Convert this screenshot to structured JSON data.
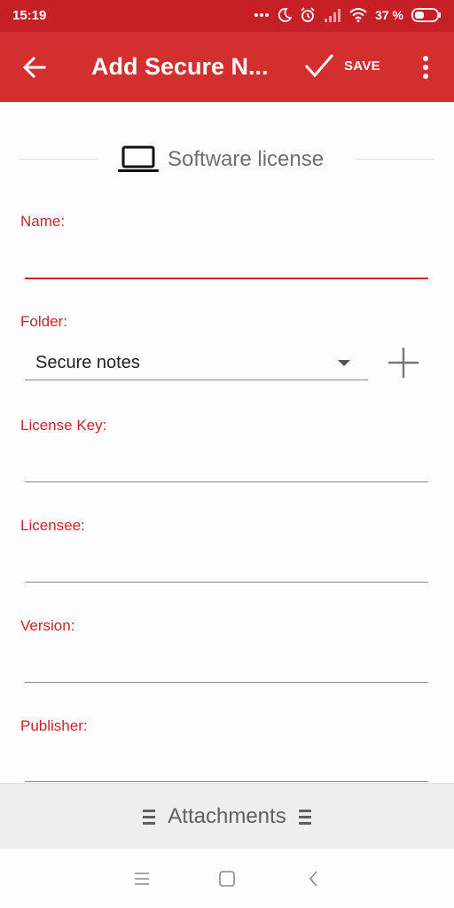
{
  "status_bar": {
    "time": "15:19",
    "battery_percent": "37 %",
    "icons": [
      "more-dots-icon",
      "moon-icon",
      "alarm-icon",
      "signal-icon",
      "wifi-icon",
      "battery-icon"
    ]
  },
  "app_bar": {
    "title": "Add Secure N...",
    "save_label": "SAVE",
    "icons": [
      "back-arrow-icon",
      "checkmark-icon",
      "more-vert-icon"
    ]
  },
  "note_type": {
    "label": "Software license",
    "icon": "laptop-icon"
  },
  "form": {
    "name_label": "Name:",
    "name_value": "",
    "folder_label": "Folder:",
    "folder_value": "Secure notes",
    "license_key_label": "License Key:",
    "license_key_value": "",
    "licensee_label": "Licensee:",
    "licensee_value": "",
    "version_label": "Version:",
    "version_value": "",
    "publisher_label": "Publisher:",
    "publisher_value": ""
  },
  "attachments": {
    "label": "Attachments",
    "icon": "drag-handle-icon"
  },
  "colors": {
    "status_bar": "#c62026",
    "app_bar": "#d32f2f",
    "label": "#c62828",
    "attachments_bar": "#eeeeee"
  }
}
